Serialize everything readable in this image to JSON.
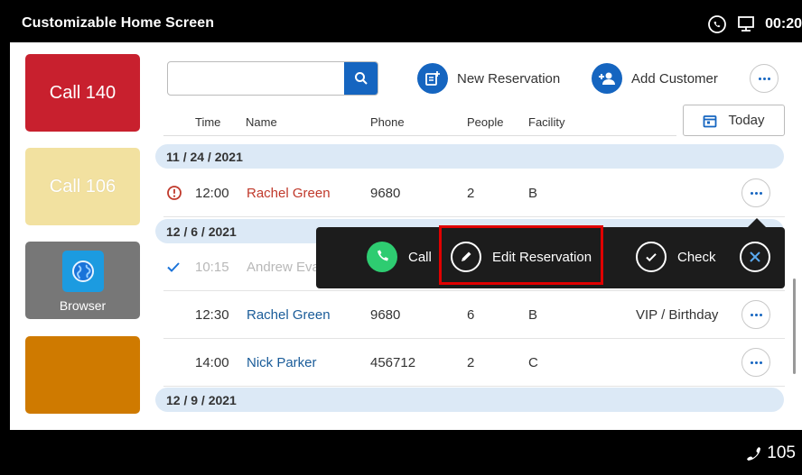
{
  "app": {
    "title": "Customizable Home Screen"
  },
  "status": {
    "time": "00:20",
    "icons": [
      "call-status-icon",
      "network-icon"
    ]
  },
  "tiles": [
    {
      "label": "Call 140",
      "color": "#c8202e"
    },
    {
      "label": "Call 106",
      "color": "#f2e1a0"
    },
    {
      "label": "Browser",
      "icon": "globe-icon",
      "color": "#777777"
    },
    {
      "label": "",
      "color": "#cf7a00"
    }
  ],
  "toolbar": {
    "search_value": "",
    "search_placeholder": "",
    "new_reservation_label": "New Reservation",
    "add_customer_label": "Add Customer",
    "today_label": "Today"
  },
  "columns": [
    "Time",
    "Name",
    "Phone",
    "People",
    "Facility"
  ],
  "groups": [
    {
      "date": "11 / 24 / 2021",
      "rows": [
        {
          "time": "12:00",
          "name": "Rachel Green",
          "phone": "9680",
          "people": "2",
          "facility": "B",
          "note": "",
          "status": "alert"
        }
      ]
    },
    {
      "date": "12 / 6 / 2021",
      "rows": [
        {
          "time": "10:15",
          "name": "Andrew Eva",
          "phone": "",
          "people": "",
          "facility": "",
          "note": "",
          "status": "checked"
        },
        {
          "time": "12:30",
          "name": "Rachel Green",
          "phone": "9680",
          "people": "6",
          "facility": "B",
          "note": "VIP / Birthday",
          "status": ""
        },
        {
          "time": "14:00",
          "name": "Nick Parker",
          "phone": "456712",
          "people": "2",
          "facility": "C",
          "note": "",
          "status": ""
        }
      ]
    },
    {
      "date": "12 / 9 / 2021",
      "rows": []
    }
  ],
  "popup": {
    "call_label": "Call",
    "edit_label": "Edit Reservation",
    "check_label": "Check"
  },
  "footer": {
    "extension": "105"
  },
  "colors": {
    "accent": "#1565c0",
    "highlight": "#e00000",
    "call_green": "#2ecc71"
  }
}
